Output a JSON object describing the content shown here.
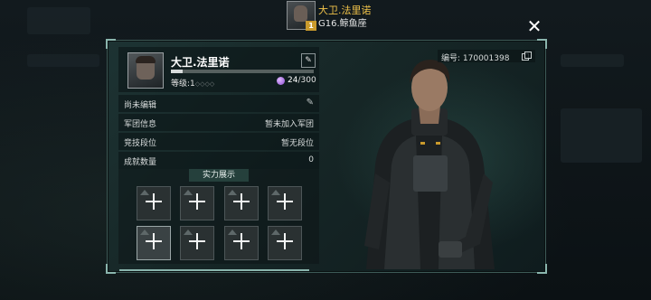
{
  "header": {
    "player_name": "大卫.法里诺",
    "server": "G16.鲸鱼座",
    "avatar_level": "1",
    "close_icon": "✕"
  },
  "profile": {
    "name": "大卫.法里诺",
    "edit_icon": "✎",
    "level_label": "等级:1",
    "level_dots": "◇◇◇◇",
    "xp_progress": 0.08,
    "stamina_current": "24",
    "stamina_max": "/300"
  },
  "info_rows": [
    {
      "label": "尚未编辑",
      "value": "",
      "icon": "✎"
    },
    {
      "label": "军团信息",
      "value": "暂未加入军团"
    },
    {
      "label": "竞技段位",
      "value": "暂无段位"
    },
    {
      "label": "成就数量",
      "value": "0"
    }
  ],
  "power_display": {
    "title": "实力展示",
    "slots": 8
  },
  "character": {
    "id_text": "编号: 170001398"
  },
  "colors": {
    "accent_gold": "#f0c34a",
    "panel_bg": "#1d3333",
    "frame": "#8ab5ad"
  }
}
